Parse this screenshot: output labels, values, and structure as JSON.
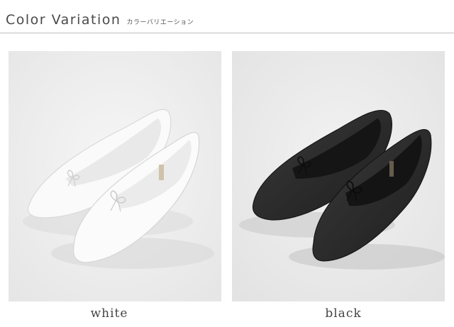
{
  "header": {
    "title": "Color Variation",
    "subtitle": "カラーバリエーション"
  },
  "variants": [
    {
      "label": "white",
      "color": "#f7f7f7"
    },
    {
      "label": "black",
      "color": "#2a2a2a"
    }
  ]
}
